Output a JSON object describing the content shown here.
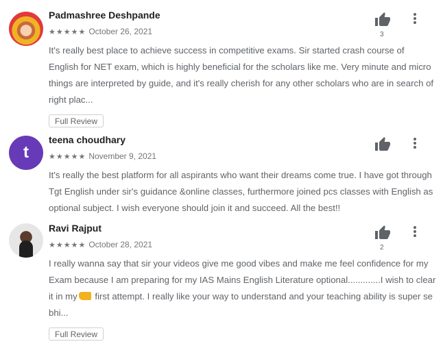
{
  "reviews": [
    {
      "name": "Padmashree Deshpande",
      "stars": "★★★★★",
      "date": "October 26, 2021",
      "text": "It's really best place to achieve success in competitive exams. Sir started crash course of English for NET exam, which is highly beneficial for the scholars like me. Very minute and micro things are interpreted by guide, and it's really cherish for any other scholars who are in search of right plac...",
      "helpful_count": "3",
      "button": "Full Review",
      "avatar_icon": "avatar-image"
    },
    {
      "name": "teena choudhary",
      "avatar_letter": "t",
      "stars": "★★★★★",
      "date": "November 9, 2021",
      "text": "It's really the best platform for all aspirants who want their dreams come true. I have got through Tgt English under sir's guidance &online classes, furthermore joined pcs classes with English as optional subject. I wish everyone should join it and succeed. All the best!!",
      "helpful_count": "",
      "avatar_color": "#673ab7"
    },
    {
      "name": "Ravi Rajput",
      "stars": "★★★★★",
      "date": "October 28, 2021",
      "text_before": "I really wanna say that sir your videos give me good vibes and make me feel confidence for my Exam because I am preparing for my IAS Mains English Literature optional.............I wish to clear it in my",
      "text_after": " first attempt. I really like your way to understand and your teaching ability is super se bhi...",
      "helpful_count": "2",
      "button": "Full Review",
      "avatar_icon": "avatar-image"
    }
  ]
}
